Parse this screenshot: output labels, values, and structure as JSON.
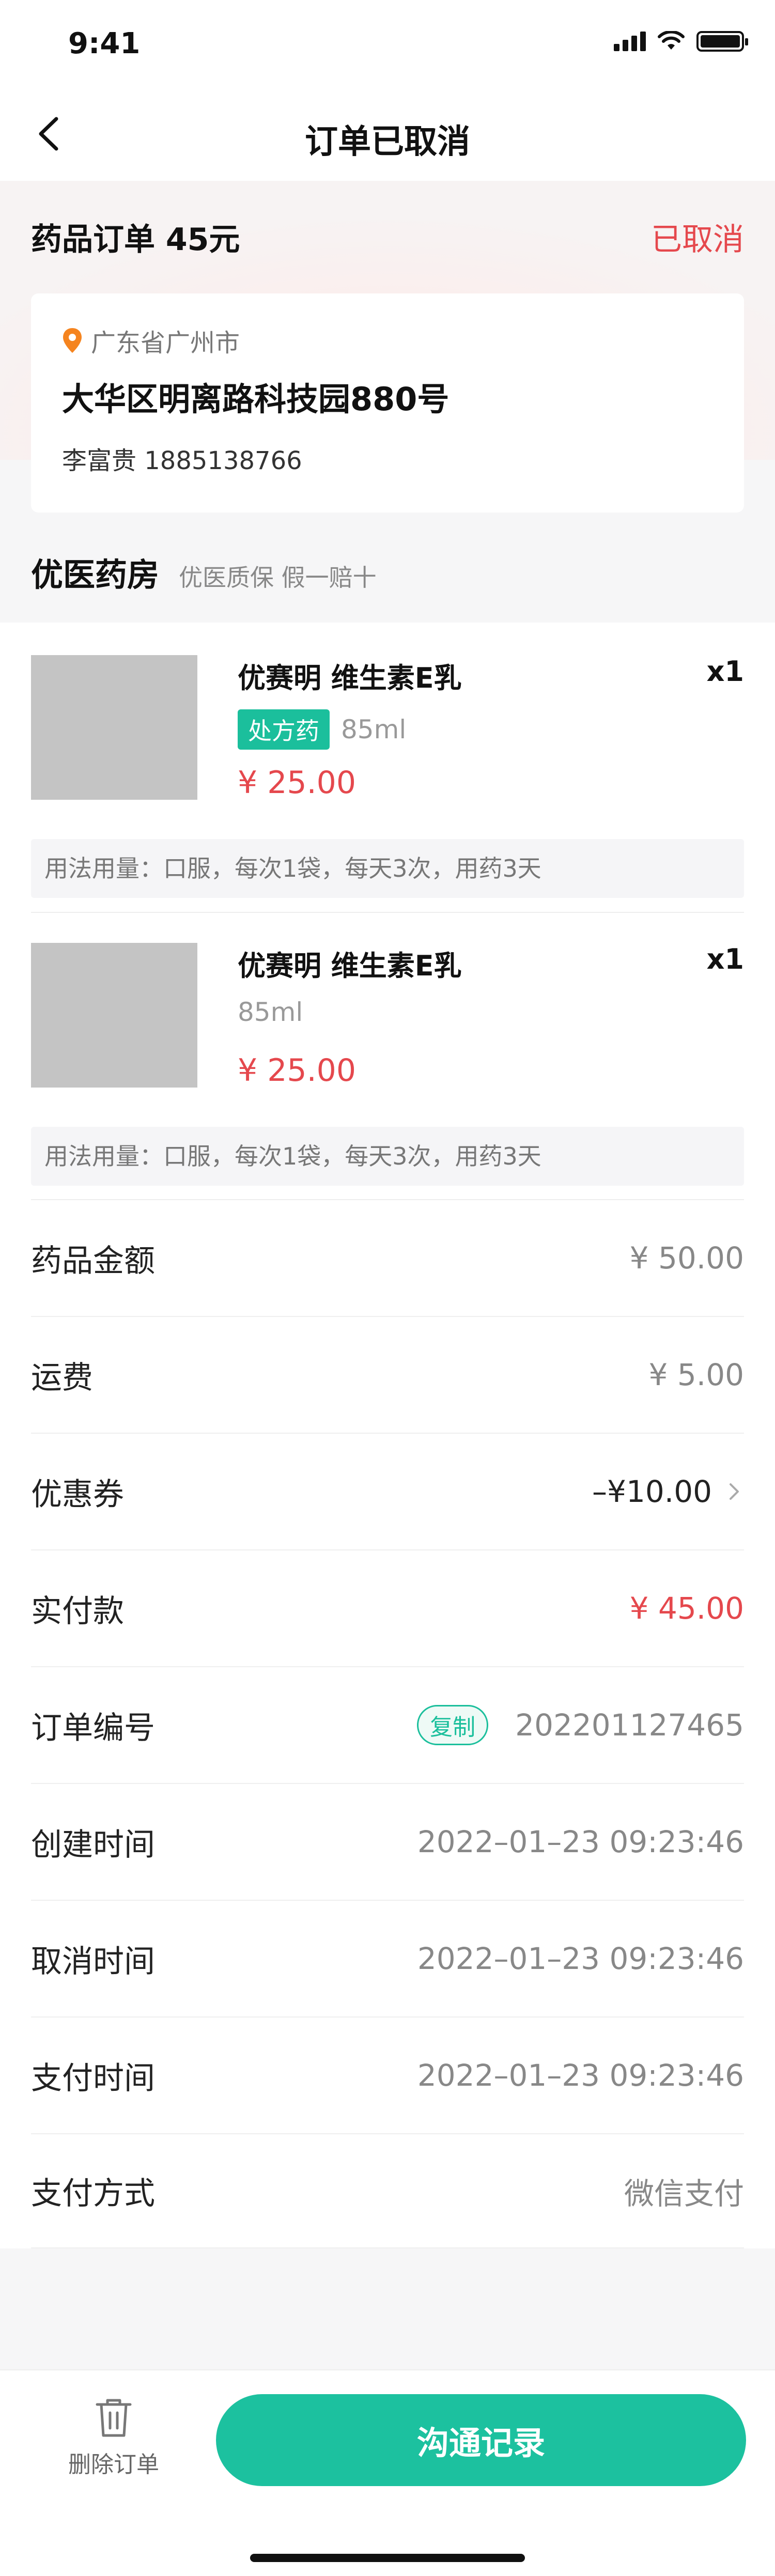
{
  "status_bar": {
    "time": "9:41"
  },
  "nav": {
    "title": "订单已取消"
  },
  "order": {
    "type_label": "药品订单 45元",
    "status": "已取消"
  },
  "address": {
    "region": "广东省广州市",
    "detail": "大华区明离路科技园880号",
    "contact": "李富贵 1885138766"
  },
  "shop": {
    "name": "优医药房",
    "tag": "优医质保 假一赔十"
  },
  "items": [
    {
      "name": "优赛明 维生素E乳",
      "qty": "x1",
      "rx_tag": "处方药",
      "spec": "85ml",
      "price": "¥ 25.00",
      "usage": "用法用量：口服，每次1袋，每天3次，用药3天"
    },
    {
      "name": "优赛明 维生素E乳",
      "qty": "x1",
      "rx_tag": "",
      "spec": "85ml",
      "price": "¥ 25.00",
      "usage": "用法用量：口服，每次1袋，每天3次，用药3天"
    }
  ],
  "summary": {
    "drug_amount": {
      "label": "药品金额",
      "value": "¥ 50.00"
    },
    "shipping": {
      "label": "运费",
      "value": "¥ 5.00"
    },
    "coupon": {
      "label": "优惠券",
      "value": "–¥10.00"
    },
    "paid": {
      "label": "实付款",
      "value": "¥ 45.00"
    },
    "order_no": {
      "label": "订单编号",
      "copy": "复制",
      "value": "202201127465"
    },
    "created": {
      "label": "创建时间",
      "value": "2022–01–23 09:23:46"
    },
    "cancelled": {
      "label": "取消时间",
      "value": "2022–01–23 09:23:46"
    },
    "pay_time": {
      "label": "支付时间",
      "value": "2022–01–23 09:23:46"
    },
    "pay_method": {
      "label": "支付方式",
      "value": "微信支付"
    }
  },
  "bottom": {
    "delete_label": "删除订单",
    "comm_label": "沟通记录"
  },
  "colors": {
    "accent": "#1cc19f",
    "danger": "#e5484d"
  }
}
